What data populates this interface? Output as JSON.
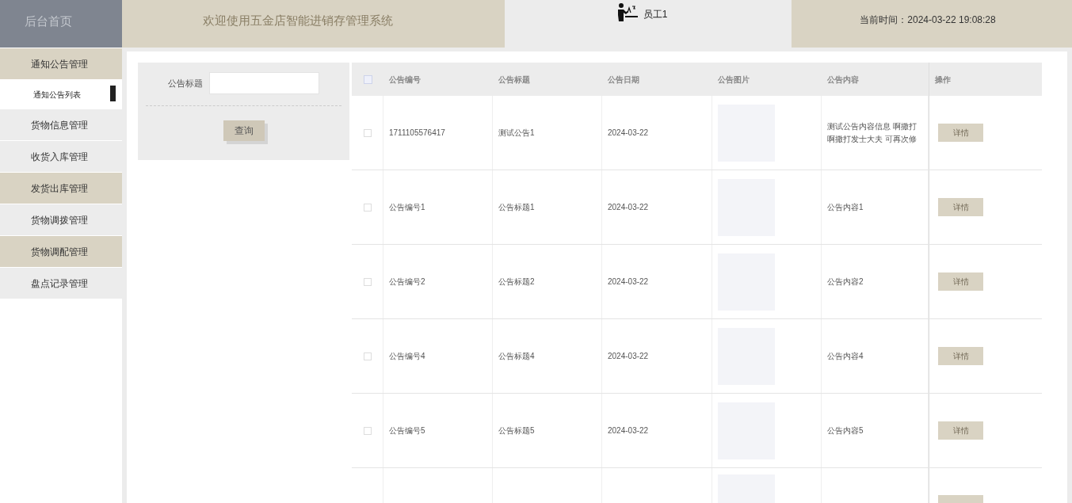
{
  "header": {
    "home": "后台首页",
    "title": "欢迎使用五金店智能进销存管理系统",
    "user": "员工1",
    "time": "当前时间：2024-03-22 19:08:28"
  },
  "sidebar": {
    "items": [
      {
        "label": "通知公告管理",
        "highlighted": true,
        "children": [
          {
            "label": "通知公告列表",
            "selected": true
          }
        ]
      },
      {
        "label": "货物信息管理",
        "highlighted": false
      },
      {
        "label": "收货入库管理",
        "highlighted": false
      },
      {
        "label": "发货出库管理",
        "highlighted": true
      },
      {
        "label": "货物调拨管理",
        "highlighted": false
      },
      {
        "label": "货物调配管理",
        "highlighted": true
      },
      {
        "label": "盘点记录管理",
        "highlighted": false
      }
    ]
  },
  "search": {
    "label": "公告标题",
    "button": "查询"
  },
  "table": {
    "select_all_checked": false,
    "columns": [
      "公告编号",
      "公告标题",
      "公告日期",
      "公告图片",
      "公告内容",
      "操作"
    ],
    "rows": [
      {
        "checked": false,
        "cells": [
          "1711105576417",
          "测试公告1",
          "2024-03-22"
        ],
        "content": [
          "测试公告内容信息 啊撒打",
          "啊撒打发士大夫 可再次修"
        ],
        "action": "详情"
      },
      {
        "checked": false,
        "cells": [
          "公告编号1",
          "公告标题1",
          "2024-03-22"
        ],
        "content": [
          "公告内容1"
        ],
        "action": "详情"
      },
      {
        "checked": false,
        "cells": [
          "公告编号2",
          "公告标题2",
          "2024-03-22"
        ],
        "content": [
          "公告内容2"
        ],
        "action": "详情"
      },
      {
        "checked": false,
        "cells": [
          "公告编号4",
          "公告标题4",
          "2024-03-22"
        ],
        "content": [
          "公告内容4"
        ],
        "action": "详情"
      },
      {
        "checked": false,
        "cells": [
          "公告编号5",
          "公告标题5",
          "2024-03-22"
        ],
        "content": [
          "公告内容5"
        ],
        "action": "详情"
      },
      {
        "kind": "cut"
      }
    ]
  }
}
